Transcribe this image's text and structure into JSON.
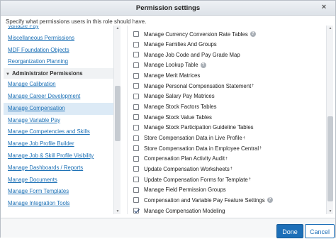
{
  "dialog": {
    "title": "Permission settings",
    "close_glyph": "×",
    "instruction": "Specify what permissions users in this role should have."
  },
  "left": {
    "items_top": [
      "Variable Pay",
      "Miscellaneous Permissions",
      "MDF Foundation Objects",
      "Reorganization Planning"
    ],
    "section_header": "Administrator Permissions",
    "section_arrow": "▼",
    "items_bottom": [
      "Manage Calibration",
      "Manage Career Development",
      "Manage Compensation",
      "Manage Variable Pay",
      "Manage Competencies and Skills",
      "Manage Job Profile Builder",
      "Manage Job & Skill Profile Visibility",
      "Manage Dashboards / Reports",
      "Manage Documents",
      "Manage Form Templates",
      "Manage Integration Tools"
    ],
    "selected": "Manage Compensation"
  },
  "permissions": [
    {
      "label": "Manage Currency Conversion Rate Tables",
      "help": true,
      "dagger": false,
      "checked": false
    },
    {
      "label": "Manage Families And Groups",
      "help": false,
      "dagger": false,
      "checked": false
    },
    {
      "label": "Manage Job Code and Pay Grade Map",
      "help": false,
      "dagger": false,
      "checked": false
    },
    {
      "label": "Manage Lookup Table",
      "help": true,
      "dagger": false,
      "checked": false
    },
    {
      "label": "Manage Merit Matrices",
      "help": false,
      "dagger": false,
      "checked": false
    },
    {
      "label": "Manage Personal Compensation Statement",
      "help": false,
      "dagger": true,
      "checked": false
    },
    {
      "label": "Manage Salary Pay Matrices",
      "help": false,
      "dagger": false,
      "checked": false
    },
    {
      "label": "Manage Stock Factors Tables",
      "help": false,
      "dagger": false,
      "checked": false
    },
    {
      "label": "Manage Stock Value Tables",
      "help": false,
      "dagger": false,
      "checked": false
    },
    {
      "label": "Manage Stock Participation Guideline Tables",
      "help": false,
      "dagger": false,
      "checked": false
    },
    {
      "label": "Store Compensation Data in Live Profile",
      "help": false,
      "dagger": true,
      "checked": false
    },
    {
      "label": "Store Compensation Data in Employee Central",
      "help": false,
      "dagger": true,
      "checked": false
    },
    {
      "label": "Compensation Plan Activity Audit",
      "help": false,
      "dagger": true,
      "checked": false
    },
    {
      "label": "Update Compensation Worksheets",
      "help": false,
      "dagger": true,
      "checked": false
    },
    {
      "label": "Update Compensation Forms for Template",
      "help": false,
      "dagger": true,
      "checked": false
    },
    {
      "label": "Manage Field Permission Groups",
      "help": false,
      "dagger": false,
      "checked": false
    },
    {
      "label": "Compensation and Variable Pay Feature Settings",
      "help": true,
      "dagger": false,
      "checked": false
    },
    {
      "label": "Manage Compensation Modeling",
      "help": false,
      "dagger": false,
      "checked": true
    }
  ],
  "symbols": {
    "help": "?",
    "dagger": "†"
  },
  "footer": {
    "done_label": "Done",
    "cancel_label": "Cancel"
  },
  "colors": {
    "link": "#1a6fb5",
    "primary_button": "#1d6fb8",
    "selected_row": "#dceaf6"
  }
}
